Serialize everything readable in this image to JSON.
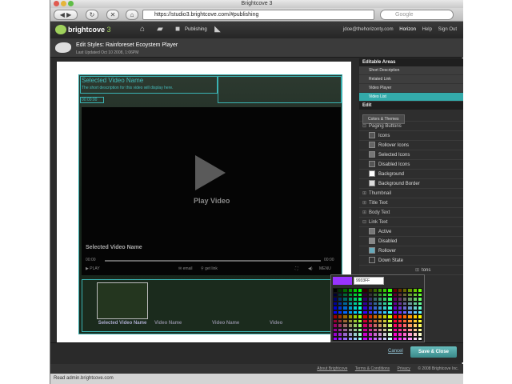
{
  "browser": {
    "title": "Brightcove 3",
    "url": "https://studio3.brightcove.com/#publishing",
    "search_placeholder": "Google",
    "status": "Read admin.brightcove.com"
  },
  "app": {
    "logo": "brightcove",
    "logo_num": "3",
    "nav_publishing": "Publishing",
    "user_email": "jdoe@thehorizonty.com",
    "links": [
      "Horizon",
      "Help",
      "Sign Out"
    ]
  },
  "edit": {
    "title": "Edit Styles: Rainforeset Ecoystem Player",
    "last_updated": "Last Updated Oct 10 2008, 1:06PM"
  },
  "player": {
    "selected_title": "Selected Video Name",
    "short_desc": "The short description for this video will display here.",
    "duration": "00:00:00",
    "play_label": "Play Video",
    "video_name": "Selected Video Name",
    "time_start": "00:00",
    "time_end": "00:00",
    "play": "PLAY",
    "email": "email",
    "getlink": "get link",
    "menu": "MENU",
    "thumbs": [
      "Selected Video Name",
      "Video Name",
      "Video Name",
      "Video"
    ]
  },
  "panel": {
    "editable_header": "Editable Areas",
    "editable_items": [
      "Short Description",
      "Related Link",
      "Video Player",
      "Video List"
    ],
    "edit_header": "Edit",
    "tab": "Colors & Themes",
    "paging_buttons": "Paging Buttons",
    "paging_items": [
      "Icons",
      "Rollover Icons",
      "Selected Icons",
      "Disabled Icons",
      "Background",
      "Background Border"
    ],
    "thumbnail": "Thumbnail",
    "title_text": "Title Text",
    "body_text": "Body Text",
    "link_text": "Link Text",
    "link_items": [
      "Active",
      "Disabled",
      "Rollover",
      "Down State"
    ],
    "buttons_partial": "tons"
  },
  "picker": {
    "hex": "9933FF",
    "selected_color": "#9933ff"
  },
  "actions": {
    "cancel": "Cancel",
    "save": "Save & Close"
  },
  "footer": {
    "links": [
      "About Brightcove",
      "Terms & Conditions",
      "Privacy"
    ],
    "copyright": "© 2008 Brightcove Inc."
  }
}
